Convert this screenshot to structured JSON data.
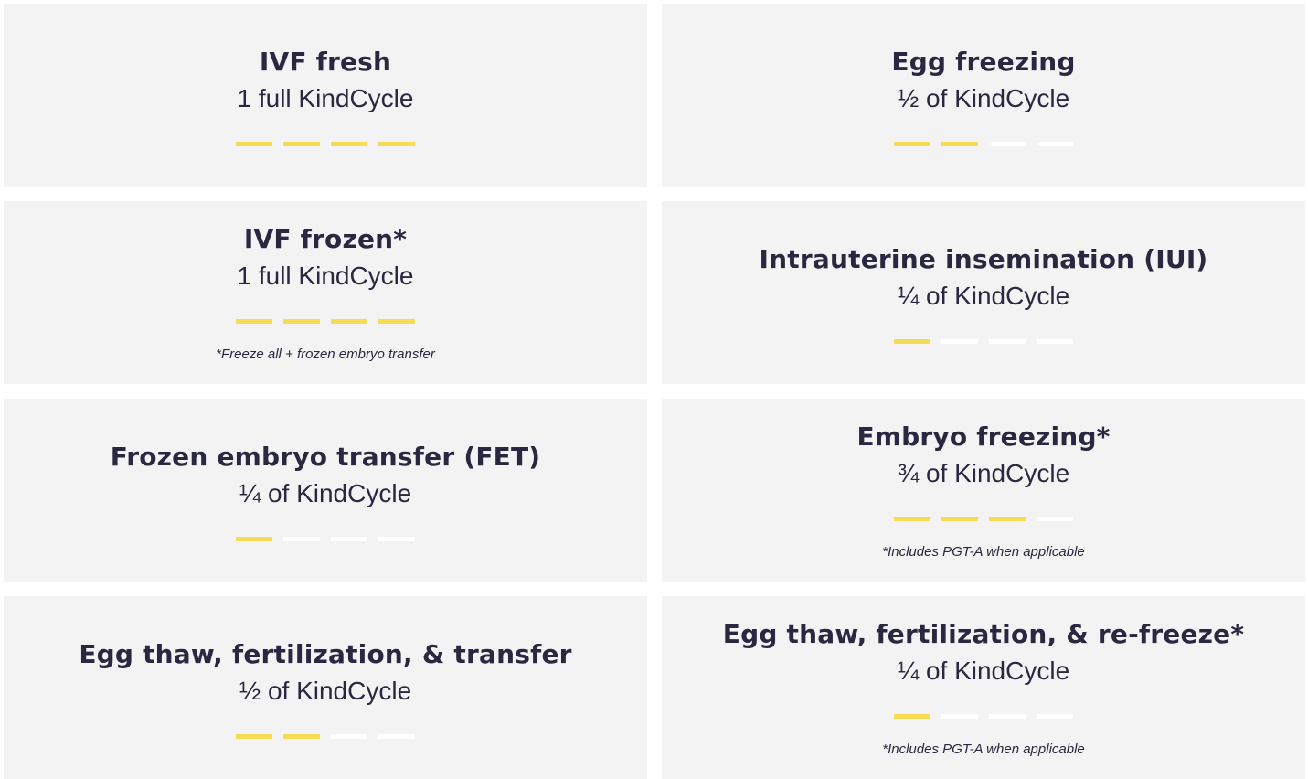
{
  "cards": [
    {
      "title": "IVF fresh",
      "subtitle": "1 full KindCycle",
      "fraction": 1.0,
      "note": ""
    },
    {
      "title": "Egg freezing",
      "subtitle": "½ of KindCycle",
      "fraction": 0.5,
      "note": ""
    },
    {
      "title": "IVF frozen*",
      "subtitle": "1 full KindCycle",
      "fraction": 1.0,
      "note": "*Freeze all + frozen embryo transfer"
    },
    {
      "title": "Intrauterine insemination (IUI)",
      "subtitle": "¼  of KindCycle",
      "fraction": 0.25,
      "note": ""
    },
    {
      "title": "Frozen embryo transfer (FET)",
      "subtitle": "¼ of KindCycle",
      "fraction": 0.25,
      "note": ""
    },
    {
      "title": "Embryo freezing*",
      "subtitle": "¾ of KindCycle",
      "fraction": 0.75,
      "note": "*Includes PGT-A when applicable"
    },
    {
      "title": "Egg thaw, fertilization, & transfer",
      "subtitle": "½ of KindCycle",
      "fraction": 0.5,
      "note": ""
    },
    {
      "title": "Egg thaw, fertilization, & re-freeze*",
      "subtitle": "¼ of KindCycle",
      "fraction": 0.25,
      "note": "*Includes PGT-A when applicable"
    }
  ],
  "colors": {
    "card_background": "#f3f3f3",
    "bar_filled": "#f6dc54",
    "bar_empty": "#ffffff",
    "text": "#2a2840"
  }
}
